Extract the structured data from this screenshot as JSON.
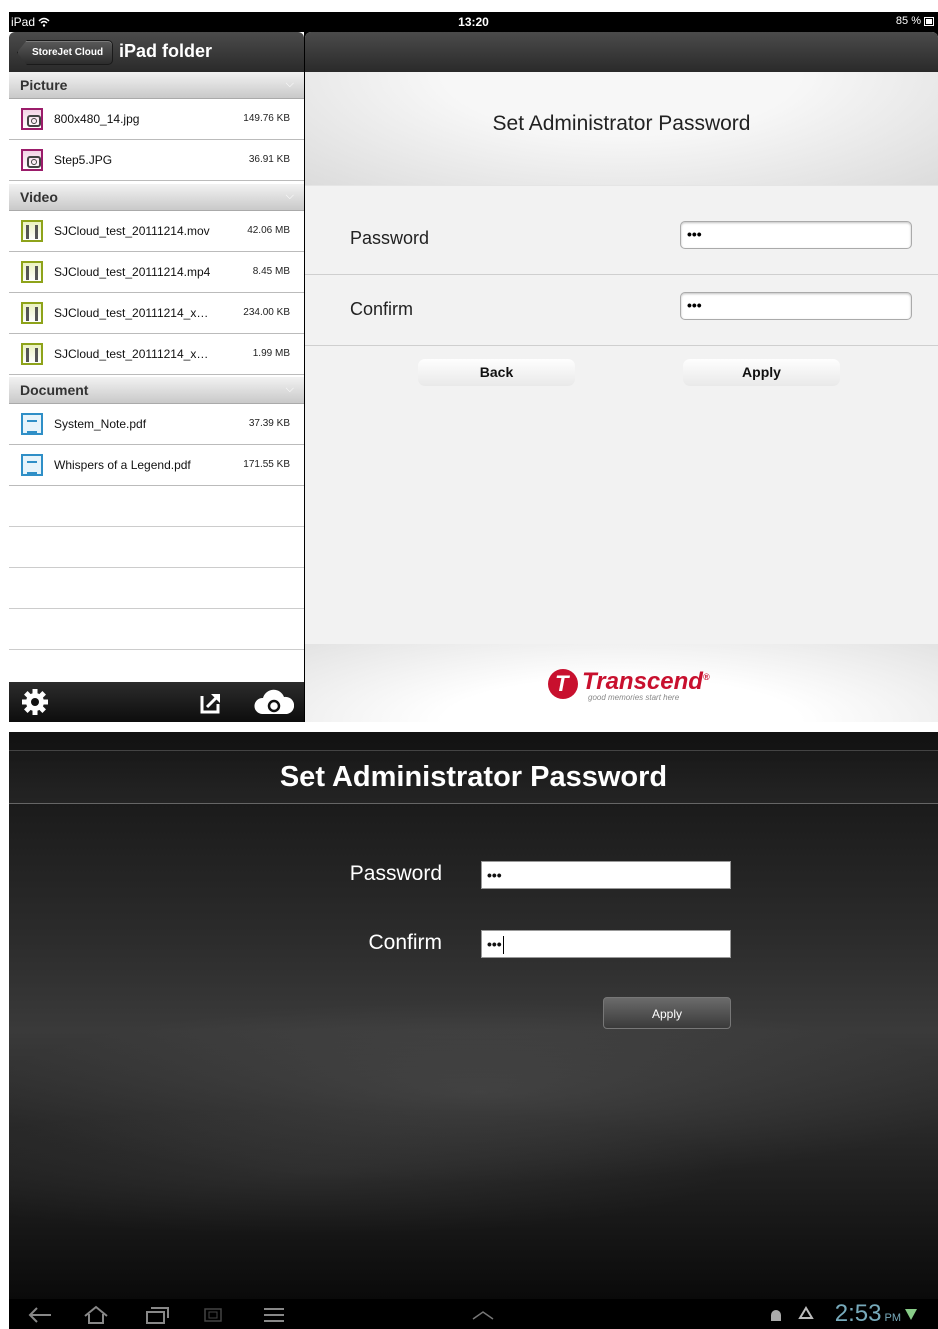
{
  "ipad": {
    "status": {
      "device": "iPad",
      "time": "13:20",
      "battery": "85 %"
    },
    "left": {
      "back_label": "StoreJet Cloud",
      "title": "iPad folder",
      "sections": [
        {
          "title": "Picture",
          "items": [
            {
              "name": "800x480_14.jpg",
              "size": "149.76 KB"
            },
            {
              "name": "Step5.JPG",
              "size": "36.91 KB"
            }
          ]
        },
        {
          "title": "Video",
          "items": [
            {
              "name": "SJCloud_test_20111214.mov",
              "size": "42.06 MB"
            },
            {
              "name": "SJCloud_test_20111214.mp4",
              "size": "8.45 MB"
            },
            {
              "name": "SJCloud_test_20111214_x…",
              "size": "234.00 KB"
            },
            {
              "name": "SJCloud_test_20111214_x…",
              "size": "1.99 MB"
            }
          ]
        },
        {
          "title": "Document",
          "items": [
            {
              "name": "System_Note.pdf",
              "size": "37.39 KB"
            },
            {
              "name": "Whispers of a Legend.pdf",
              "size": "171.55 KB"
            }
          ]
        }
      ],
      "toolbar_icons": [
        "gear-icon",
        "export-icon",
        "cloud-sync-icon"
      ]
    },
    "right": {
      "title": "Set Administrator Password",
      "password_label": "Password",
      "password_value": "•••",
      "confirm_label": "Confirm",
      "confirm_value": "•••",
      "back_button": "Back",
      "apply_button": "Apply",
      "brand": "Transcend",
      "brand_reg": "®",
      "tagline": "good memories start here",
      "brand_color": "#c8102e"
    }
  },
  "android": {
    "title": "Set Administrator Password",
    "password_label": "Password",
    "password_value": "•••",
    "confirm_label": "Confirm",
    "confirm_value": "•••",
    "apply_button": "Apply",
    "clock": "2:53",
    "ampm": "PM"
  }
}
